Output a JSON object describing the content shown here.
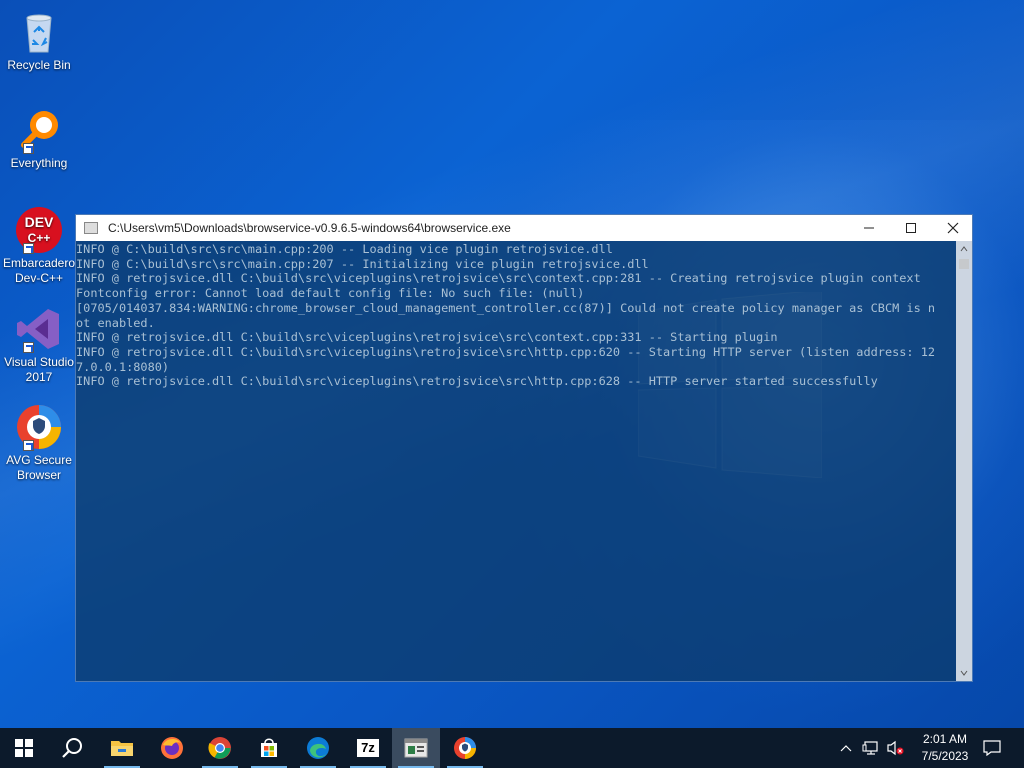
{
  "desktop": {
    "icons": [
      {
        "name": "recycle-bin",
        "label": "Recycle Bin"
      },
      {
        "name": "everything",
        "label": "Everything"
      },
      {
        "name": "embarcadero-dev-cpp",
        "label": "Embarcadero Dev-C++"
      },
      {
        "name": "visual-studio-2017",
        "label": "Visual Studio 2017"
      },
      {
        "name": "avg-secure-browser",
        "label": "AVG Secure Browser"
      }
    ],
    "devcpp_icon_text": {
      "line1": "DEV",
      "line2": "C++"
    }
  },
  "console": {
    "title": "C:\\Users\\vm5\\Downloads\\browservice-v0.9.6.5-windows64\\browservice.exe",
    "lines": [
      "INFO @ C:\\build\\src\\src\\main.cpp:200 -- Loading vice plugin retrojsvice.dll",
      "INFO @ C:\\build\\src\\src\\main.cpp:207 -- Initializing vice plugin retrojsvice.dll",
      "INFO @ retrojsvice.dll C:\\build\\src\\viceplugins\\retrojsvice\\src\\context.cpp:281 -- Creating retrojsvice plugin context",
      "Fontconfig error: Cannot load default config file: No such file: (null)",
      "[0705/014037.834:WARNING:chrome_browser_cloud_management_controller.cc(87)] Could not create policy manager as CBCM is n",
      "ot enabled.",
      "INFO @ retrojsvice.dll C:\\build\\src\\viceplugins\\retrojsvice\\src\\context.cpp:331 -- Starting plugin",
      "INFO @ retrojsvice.dll C:\\build\\src\\viceplugins\\retrojsvice\\src\\http.cpp:620 -- Starting HTTP server (listen address: 12",
      "7.0.0.1:8080)",
      "INFO @ retrojsvice.dll C:\\build\\src\\viceplugins\\retrojsvice\\src\\http.cpp:628 -- HTTP server started successfully"
    ]
  },
  "taskbar": {
    "apps": [
      {
        "name": "start",
        "icon": "windows-logo-icon"
      },
      {
        "name": "search",
        "icon": "search-icon"
      },
      {
        "name": "file-explorer",
        "icon": "folder-icon",
        "running": true
      },
      {
        "name": "firefox",
        "icon": "firefox-icon"
      },
      {
        "name": "chrome",
        "icon": "chrome-icon",
        "running": true
      },
      {
        "name": "microsoft-store",
        "icon": "store-icon",
        "running": true
      },
      {
        "name": "edge",
        "icon": "edge-icon",
        "running": true
      },
      {
        "name": "7zip",
        "icon": "7zip-icon",
        "label": "7z",
        "running": true
      },
      {
        "name": "browservice-console",
        "icon": "console-icon",
        "running": true,
        "active": true
      },
      {
        "name": "avg-secure-browser",
        "icon": "avg-browser-icon",
        "running": true
      }
    ],
    "clock": {
      "time": "2:01 AM",
      "date": "7/5/2023"
    }
  },
  "colors": {
    "taskbar": "#0c1a2b",
    "accent": "#76b9ed",
    "console_text": "#a9c0d4"
  }
}
